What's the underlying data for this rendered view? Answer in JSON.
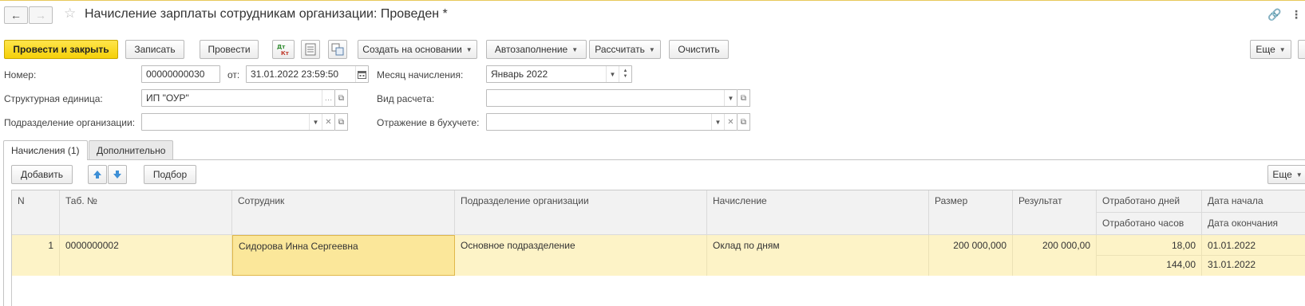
{
  "header": {
    "title": "Начисление зарплаты сотрудникам организации: Проведен *",
    "back_icon": "←",
    "forward_icon": "→",
    "star_icon": "☆",
    "link_icon": "🔗",
    "more_icon": "⋮"
  },
  "toolbar": {
    "post_close": "Провести и закрыть",
    "save": "Записать",
    "post": "Провести",
    "create_based": "Создать на основании",
    "autofill": "Автозаполнение",
    "calculate": "Рассчитать",
    "clear": "Очистить",
    "more": "Еще"
  },
  "form": {
    "number_label": "Номер:",
    "number_value": "00000000030",
    "from_label": "от:",
    "date_value": "31.01.2022 23:59:50",
    "month_label": "Месяц начисления:",
    "month_value": "Январь 2022",
    "unit_label": "Структурная единица:",
    "unit_value": "ИП \"ОУР\"",
    "calc_type_label": "Вид расчета:",
    "calc_type_value": "",
    "dept_label": "Подразделение организации:",
    "dept_value": "",
    "accounting_label": "Отражение в бухучете:",
    "accounting_value": ""
  },
  "tabs": [
    "Начисления (1)",
    "Дополнительно"
  ],
  "table_toolbar": {
    "add": "Добавить",
    "select": "Подбор",
    "more": "Еще"
  },
  "table": {
    "columns": {
      "n": "N",
      "tab": "Таб. №",
      "employee": "Сотрудник",
      "department": "Подразделение организации",
      "accrual": "Начисление",
      "size": "Размер",
      "result": "Результат",
      "days": "Отработано дней",
      "hours": "Отработано часов",
      "start": "Дата начала",
      "end": "Дата окончания"
    },
    "rows": [
      {
        "n": "1",
        "tab": "0000000002",
        "employee": "Сидорова Инна Сергеевна",
        "department": "Основное подразделение",
        "accrual": "Оклад по дням",
        "size": "200 000,000",
        "result": "200 000,00",
        "days": "18,00",
        "hours": "144,00",
        "start": "01.01.2022",
        "end": "31.01.2022"
      }
    ]
  },
  "colors": {
    "primary_button": "#f5d009",
    "selected_row": "#fdf3c7",
    "selected_cell": "#fbe79a"
  }
}
